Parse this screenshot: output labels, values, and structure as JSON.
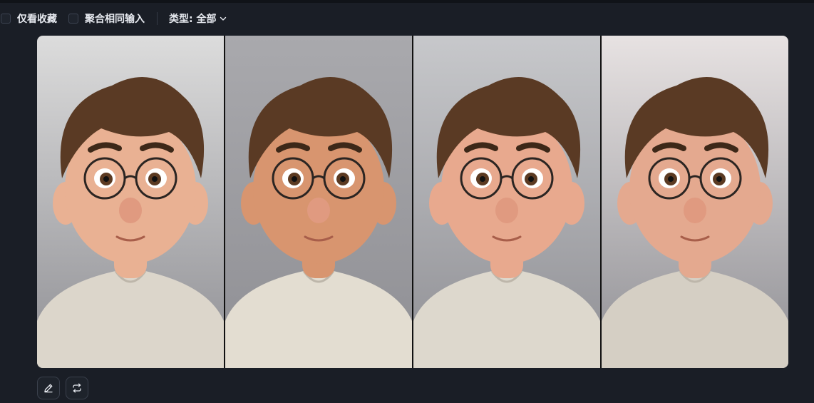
{
  "filters": {
    "favorites_only": {
      "label": "仅看收藏",
      "checked": false
    },
    "group_same_input": {
      "label": "聚合相同输入",
      "checked": false
    }
  },
  "type_select": {
    "label": "类型: 全部"
  },
  "gallery": {
    "images": [
      {
        "icon": "cartoon-boy-glasses-portrait",
        "bg": "#dcdcdc",
        "skin": "#e9b193",
        "shirt": "#dcd6cb"
      },
      {
        "icon": "cartoon-boy-glasses-portrait",
        "bg": "#a9a9ad",
        "skin": "#d8956f",
        "shirt": "#e3ddd1"
      },
      {
        "icon": "cartoon-boy-glasses-portrait",
        "bg": "#c7c8cb",
        "skin": "#e8a98e",
        "shirt": "#ddd8cd"
      },
      {
        "icon": "cartoon-boy-glasses-portrait",
        "bg": "#e7e2e2",
        "skin": "#e4a98f",
        "shirt": "#d5cfc4"
      }
    ]
  },
  "actions": [
    {
      "icon": "edit-pencil-icon"
    },
    {
      "icon": "regenerate-icon"
    }
  ],
  "colors": {
    "background": "#1a1e26",
    "text": "#e6e9ef",
    "hair": "#5a3a24",
    "glasses": "#2b2522"
  }
}
